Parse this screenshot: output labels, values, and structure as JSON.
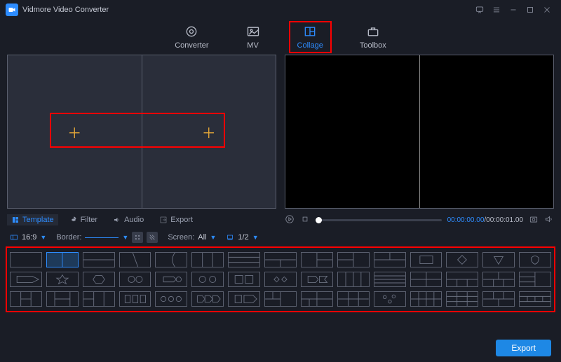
{
  "app": {
    "title": "Vidmore Video Converter"
  },
  "tabs": {
    "converter": "Converter",
    "mv": "MV",
    "collage": "Collage",
    "toolbox": "Toolbox",
    "active": "collage"
  },
  "mid_tabs": {
    "template": "Template",
    "filter": "Filter",
    "audio": "Audio",
    "export": "Export"
  },
  "playback": {
    "current": "00:00:00.00",
    "duration": "00:00:01.00"
  },
  "toolbar": {
    "aspect": "16:9",
    "border_label": "Border:",
    "screen_label": "Screen:",
    "screen_value": "All",
    "page": "1/2"
  },
  "buttons": {
    "export": "Export"
  }
}
